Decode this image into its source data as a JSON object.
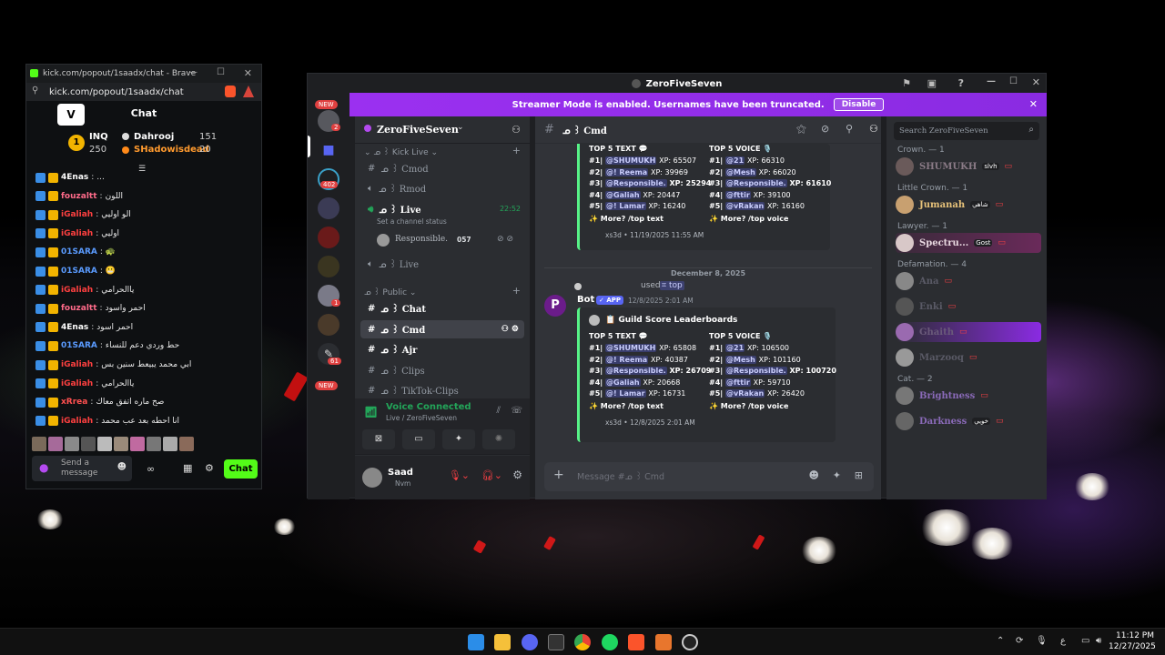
{
  "kick": {
    "title": "kick.com/popout/1saadx/chat - Brave",
    "url": "kick.com/popout/1saadx/chat",
    "chat_heading": "Chat",
    "leaderboard": {
      "rank": "1",
      "user1": "INQ",
      "user1_value": "250",
      "user2": "Dahrooj",
      "user2_value": "151",
      "user3": "SHadowisdead",
      "user3_value": "20"
    },
    "messages": [
      {
        "user": "4Enas",
        "text": "...",
        "color": "#ffffff"
      },
      {
        "user": "fouzaltt",
        "text": "اللون",
        "color": "#ff6b8a"
      },
      {
        "user": "iGaliah",
        "text": "الو اوليي",
        "color": "#ff4040"
      },
      {
        "user": "iGaliah",
        "text": "اوليي",
        "color": "#ff4040"
      },
      {
        "user": "01SARA",
        "text": "🐢",
        "color": "#5a9bff"
      },
      {
        "user": "01SARA",
        "text": "😬",
        "color": "#5a9bff"
      },
      {
        "user": "iGaliah",
        "text": "ياالحرامي",
        "color": "#ff4040"
      },
      {
        "user": "fouzaltt",
        "text": "احمر واسود",
        "color": "#ff6b8a"
      },
      {
        "user": "4Enas",
        "text": "احمر اسود",
        "color": "#ffffff"
      },
      {
        "user": "01SARA",
        "text": "حط وردي دعم للنساء",
        "color": "#5a9bff"
      },
      {
        "user": "iGaliah",
        "text": "ابي محمد يبيعط سنين بس",
        "color": "#ff4040"
      },
      {
        "user": "iGaliah",
        "text": "ياالحرامي",
        "color": "#ff4040"
      },
      {
        "user": "xRrea",
        "text": "صح ماره اتفق معاك",
        "color": "#ff5050"
      },
      {
        "user": "iGaliah",
        "text": "انا احطه بعد عب محمد",
        "color": "#ff4040"
      }
    ],
    "send_placeholder": "Send a message",
    "chat_button": "Chat"
  },
  "discord": {
    "window_title": "ZeroFiveSeven",
    "streamer_banner": "Streamer Mode is enabled. Usernames have been truncated.",
    "disable_button": "Disable",
    "server_name": "ZeroFiveSeven",
    "badges": {
      "new_top": "NEW",
      "new_bottom": "NEW",
      "b402": "402",
      "b61": "61",
      "b2": "2",
      "b1": "1"
    },
    "categories": {
      "kick_live": "Kick Live",
      "public": "Public"
    },
    "channels": [
      "Cmod",
      "Rmod",
      "Live",
      "Live",
      "Chat",
      "Cmd",
      "Ajr",
      "Clips",
      "TikTok-Clips"
    ],
    "live_time": "22:52",
    "channel_status": "Set a channel status",
    "voice_user": "Responsible.",
    "voice_user_tag": "057",
    "voice_connected": "Voice Connected",
    "voice_channel": "Live / ZeroFiveSeven",
    "user_name": "Saad",
    "user_status": "Nvm",
    "current_channel": "Cmd",
    "search_placeholder": "Search ZeroFiveSeven",
    "date_divider": "December 8, 2025",
    "used_text": "used",
    "used_cmd": "top",
    "bot_name": "Bot",
    "bot_tag": "APP",
    "bot_time": "12/8/2025 2:01 AM",
    "embed_title": "Guild Score Leaderboards",
    "message_placeholder": "Message #ᓄ ꒱ Cmd",
    "embed1": {
      "text_title": "TOP 5 TEXT 💬",
      "voice_title": "TOP 5 VOICE 🎙️",
      "text_rows": [
        {
          "rank": "#1|",
          "user": "@SHUMUKH",
          "xp": "XP: 65507"
        },
        {
          "rank": "#2|",
          "user": "@! Reema",
          "xp": "XP: 39969"
        },
        {
          "rank": "#3|",
          "user": "@Responsible.",
          "xp": "XP: 25294"
        },
        {
          "rank": "#4|",
          "user": "@Galiah",
          "xp": "XP: 20447"
        },
        {
          "rank": "#5|",
          "user": "@! Lamar",
          "xp": "XP: 16240"
        }
      ],
      "voice_rows": [
        {
          "rank": "#1|",
          "user": "@21",
          "xp": "XP: 66310"
        },
        {
          "rank": "#2|",
          "user": "@Mesh",
          "xp": "XP: 66020"
        },
        {
          "rank": "#3|",
          "user": "@Responsible.",
          "xp": "XP: 61610"
        },
        {
          "rank": "#4|",
          "user": "@fttir",
          "xp": "XP: 39100"
        },
        {
          "rank": "#5|",
          "user": "@vRakan",
          "xp": "XP: 16160"
        }
      ],
      "more_text": "✨ More? /top text",
      "more_voice": "✨ More? /top voice",
      "footer": "xs3d • 11/19/2025 11:55 AM"
    },
    "embed2": {
      "text_title": "TOP 5 TEXT 💬",
      "voice_title": "TOP 5 VOICE 🎙️",
      "text_rows": [
        {
          "rank": "#1|",
          "user": "@SHUMUKH",
          "xp": "XP: 65808"
        },
        {
          "rank": "#2|",
          "user": "@! Reema",
          "xp": "XP: 40387"
        },
        {
          "rank": "#3|",
          "user": "@Responsible.",
          "xp": "XP: 26709"
        },
        {
          "rank": "#4|",
          "user": "@Galiah",
          "xp": "XP: 20668"
        },
        {
          "rank": "#5|",
          "user": "@! Lamar",
          "xp": "XP: 16731"
        }
      ],
      "voice_rows": [
        {
          "rank": "#1|",
          "user": "@21",
          "xp": "XP: 106500"
        },
        {
          "rank": "#2|",
          "user": "@Mesh",
          "xp": "XP: 101160"
        },
        {
          "rank": "#3|",
          "user": "@Responsible.",
          "xp": "XP: 100720"
        },
        {
          "rank": "#4|",
          "user": "@fttir",
          "xp": "XP: 59710"
        },
        {
          "rank": "#5|",
          "user": "@vRakan",
          "xp": "XP: 26420"
        }
      ],
      "more_text": "✨ More? /top text",
      "more_voice": "✨ More? /top voice",
      "footer": "xs3d • 12/8/2025 2:01 AM"
    },
    "member_groups": [
      {
        "label": "Crown. — 1",
        "members": [
          {
            "name": "SHUMUKH",
            "tag": "slvh",
            "color": "#8a7a86"
          }
        ]
      },
      {
        "label": "Little Crown. — 1",
        "members": [
          {
            "name": "Jumanah",
            "tag": "شاهي",
            "color": "#e8c37a"
          }
        ]
      },
      {
        "label": "Lawyer. — 1",
        "members": [
          {
            "name": "Spectru...",
            "tag": "Gost",
            "color": "#e8d8e0"
          }
        ]
      },
      {
        "label": "Defamation. — 4",
        "members": [
          {
            "name": "Ana",
            "tag": "",
            "color": "#5a5a66"
          },
          {
            "name": "Enki",
            "tag": "",
            "color": "#5a5a66"
          },
          {
            "name": "Ghaith",
            "tag": "",
            "color": "#6a5a7a"
          },
          {
            "name": "Marzooq",
            "tag": "",
            "color": "#5a5a66"
          }
        ]
      },
      {
        "label": "Cat. — 2",
        "members": [
          {
            "name": "Brightness",
            "tag": "",
            "color": "#8a6ab8"
          },
          {
            "name": "Darkness",
            "tag": "خويي",
            "color": "#8a6ab8"
          }
        ]
      }
    ]
  },
  "taskbar": {
    "lang": "ع",
    "time": "11:12 PM",
    "date": "12/27/2025"
  }
}
